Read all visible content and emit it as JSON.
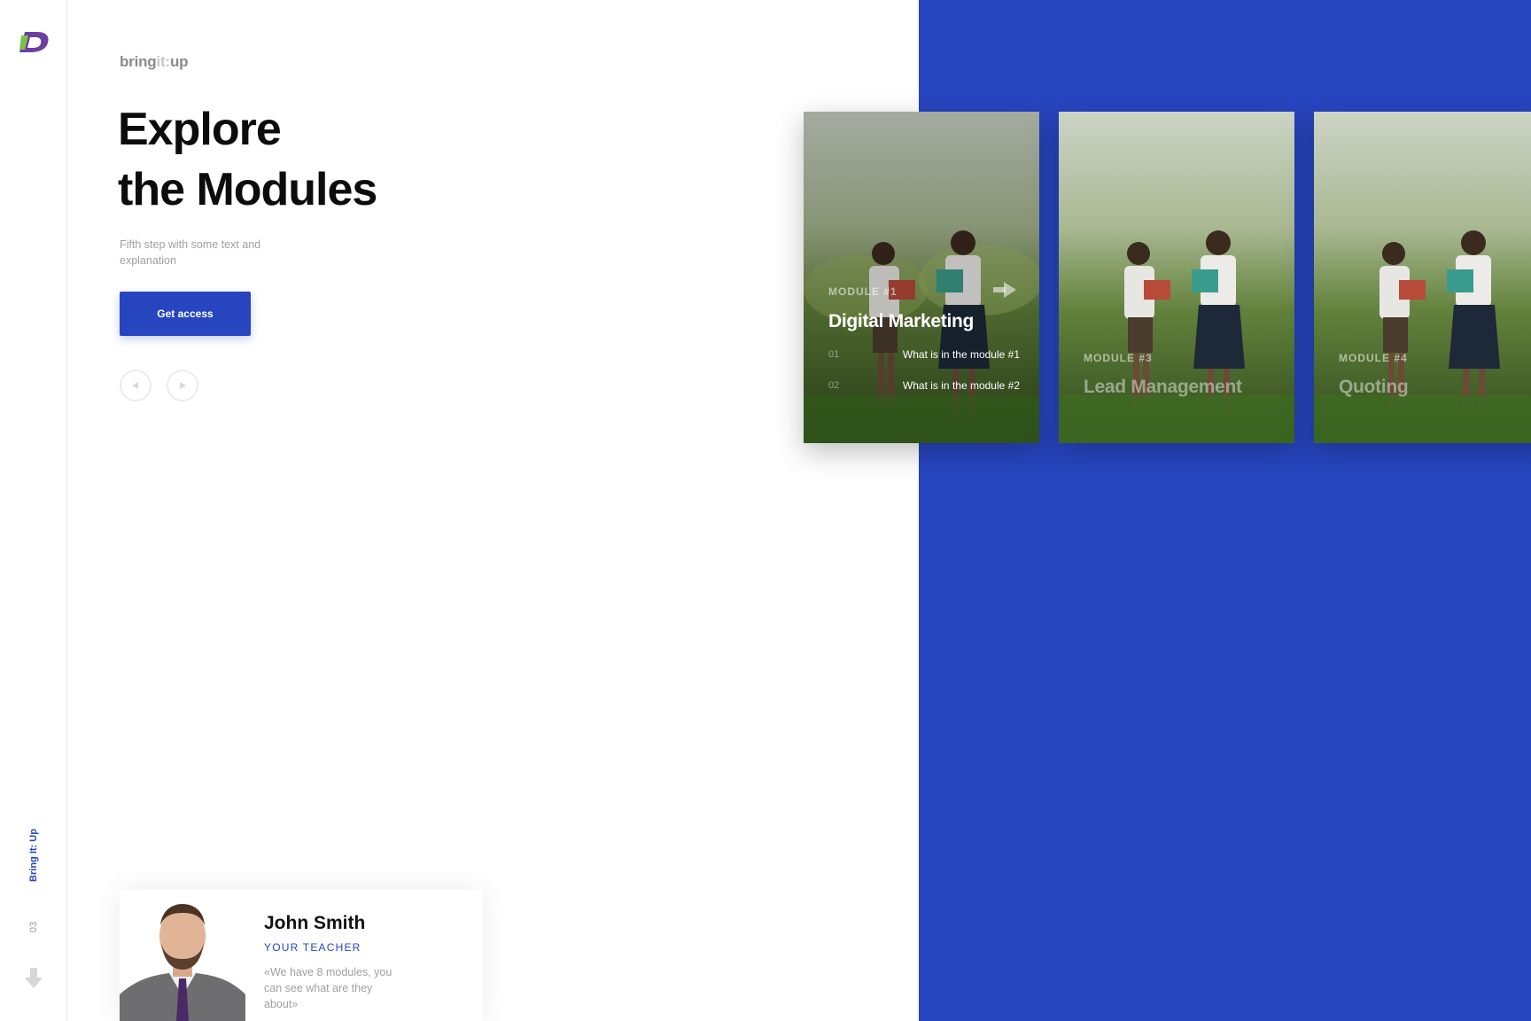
{
  "sidebar": {
    "brand": "Bring It: Up",
    "slide_number": "03",
    "logo_icon": "logo-mark-icon",
    "down_icon": "arrow-down-icon"
  },
  "header": {
    "brand_parts": [
      "bring",
      "it:",
      "up"
    ]
  },
  "hero": {
    "title_line1": "Explore",
    "title_line2": "the Modules",
    "subtitle": "Fifth step with some text and explanation",
    "cta_label": "Get access"
  },
  "nav": {
    "prev_icon": "play-left-icon",
    "next_icon": "play-right-icon"
  },
  "modules": [
    {
      "label": "MODULE #1",
      "title": "Digital Marketing",
      "items": [
        {
          "num": "01",
          "text": "What is in the module #1"
        },
        {
          "num": "02",
          "text": "What is in the module #2"
        }
      ]
    },
    {
      "label": "MODULE #3",
      "title": "Lead Management"
    },
    {
      "label": "MODULE #4",
      "title": "Quoting"
    }
  ],
  "teacher": {
    "name": "John Smith",
    "role": "YOUR TEACHER",
    "quote": "«We have 8 modules, you can see what are they about»"
  },
  "colors": {
    "accent": "#2745bf",
    "text_dark": "#0c0c0c",
    "text_muted": "#a0a0a0"
  }
}
